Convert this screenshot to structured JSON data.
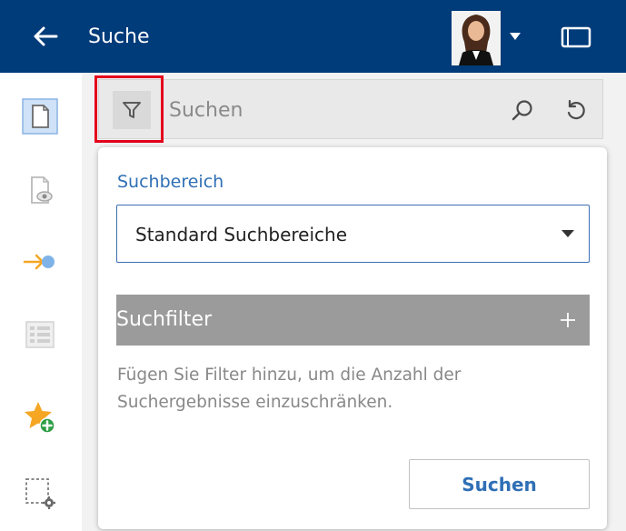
{
  "header": {
    "title": "Suche",
    "back_icon": "arrow-left-icon",
    "background_color": "#003b7a"
  },
  "search": {
    "placeholder": "Suchen",
    "value": ""
  },
  "sidebar": {
    "items": [
      {
        "name": "document-icon",
        "active": true
      },
      {
        "name": "document-preview-icon"
      },
      {
        "name": "workflow-arrow-icon"
      },
      {
        "name": "list-view-icon"
      },
      {
        "name": "favorite-add-icon"
      },
      {
        "name": "selection-settings-icon"
      }
    ]
  },
  "panel": {
    "scope_label": "Suchbereich",
    "scope_value": "Standard Suchbereiche",
    "filter_title": "Suchfilter",
    "filter_hint": "Fügen Sie Filter hinzu, um die Anzahl der Suchergebnisse einzuschränken.",
    "submit_label": "Suchen"
  },
  "colors": {
    "accent": "#2f6fb5",
    "highlight": "#e3001b",
    "filter_header": "#9b9b9b",
    "favorite_star": "#f5a623",
    "favorite_plus": "#2e9d45"
  }
}
